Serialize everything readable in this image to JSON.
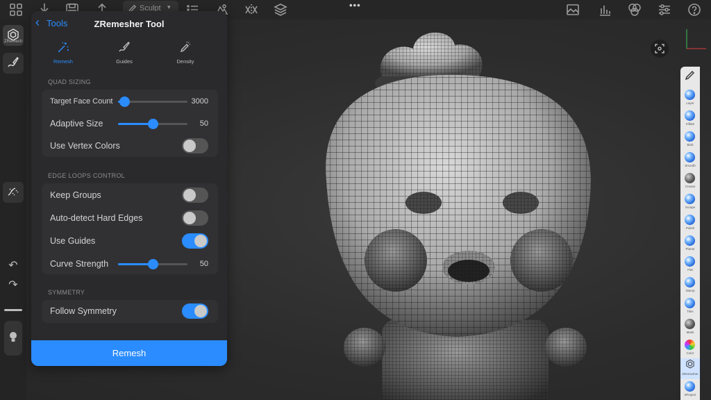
{
  "toolbar": {
    "sculpt_label": "Sculpt",
    "caret": "▾",
    "more": "•••",
    "icons": [
      "grid-icon",
      "import-icon",
      "save-icon",
      "export-icon",
      "brush-icon",
      "list-icon",
      "material-icon",
      "symmetry-icon",
      "layers-icon",
      "image-icon",
      "stats-icon",
      "color-wheel-icon",
      "sliders-icon",
      "help-icon"
    ]
  },
  "left_rail": {
    "zremesh_caption": "ZRemesh",
    "undo": "↶",
    "redo": "↷"
  },
  "panel": {
    "back_label": "Tools",
    "title": "ZRemesher Tool",
    "tabs": [
      {
        "label": "Remesh",
        "active": true
      },
      {
        "label": "Guides",
        "active": false
      },
      {
        "label": "Density",
        "active": false
      }
    ],
    "quad_sizing": {
      "section_label": "QUAD SIZING",
      "target_face_count": {
        "label": "Target Face Count",
        "value": "3000",
        "level": 0.09
      },
      "adaptive_size": {
        "label": "Adaptive Size",
        "value": "50",
        "level": 0.5
      },
      "use_vertex_colors": {
        "label": "Use Vertex Colors",
        "on": false
      }
    },
    "edge_loops": {
      "section_label": "EDGE LOOPS CONTROL",
      "keep_groups": {
        "label": "Keep Groups",
        "on": false
      },
      "auto_detect": {
        "label": "Auto-detect Hard Edges",
        "on": false
      },
      "use_guides": {
        "label": "Use Guides",
        "on": true
      },
      "curve_strength": {
        "label": "Curve Strength",
        "value": "50",
        "level": 0.5
      }
    },
    "symmetry": {
      "section_label": "SYMMETRY",
      "follow_symmetry": {
        "label": "Follow Symmetry",
        "on": true
      }
    },
    "remesh_button": "Remesh"
  },
  "brushes": {
    "items": [
      "Layer",
      "Inflate",
      "Blob",
      "Smooth",
      "Crease",
      "Scrape",
      "Polish",
      "Planar",
      "Flat",
      "Stamp",
      "Tiles",
      "Mask",
      "Color",
      "ZRemesher",
      "ZProject"
    ]
  },
  "colors": {
    "accent": "#2a8cff",
    "panel": "#2a2a2c"
  }
}
